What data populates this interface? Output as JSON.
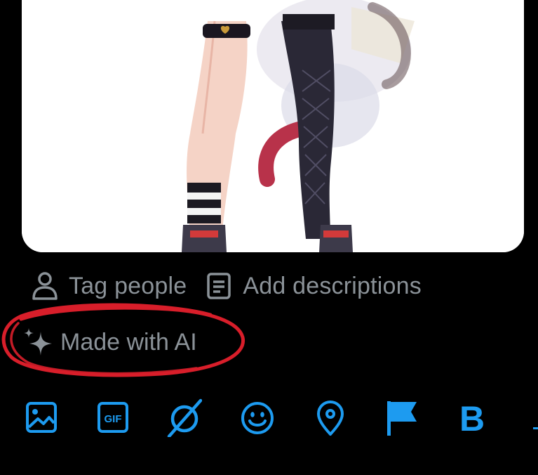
{
  "media": {
    "image_alt": ""
  },
  "media_actions": {
    "tag_people_label": "Tag people",
    "tag_people_icon": "person-outline-icon",
    "add_descriptions_label": "Add descriptions",
    "add_descriptions_icon": "document-lines-icon"
  },
  "ai_label": {
    "label": "Made with AI",
    "icon": "sparkles-icon"
  },
  "annotation": {
    "color": "#d81e2a",
    "shape": "hand-drawn-ellipse"
  },
  "toolbar": {
    "accent_color": "#1d9bf0",
    "items": [
      {
        "name": "media-button",
        "icon": "image-icon"
      },
      {
        "name": "gif-button",
        "icon": "gif-icon",
        "text": "GIF"
      },
      {
        "name": "grok-button",
        "icon": "grok-icon"
      },
      {
        "name": "emoji-button",
        "icon": "smiley-icon"
      },
      {
        "name": "location-button",
        "icon": "location-pin-icon"
      },
      {
        "name": "flag-button",
        "icon": "flag-icon"
      },
      {
        "name": "bold-button",
        "icon": "bold-icon",
        "text": "B"
      }
    ]
  },
  "colors": {
    "background": "#000000",
    "muted_text": "#8b9298",
    "accent": "#1d9bf0"
  }
}
